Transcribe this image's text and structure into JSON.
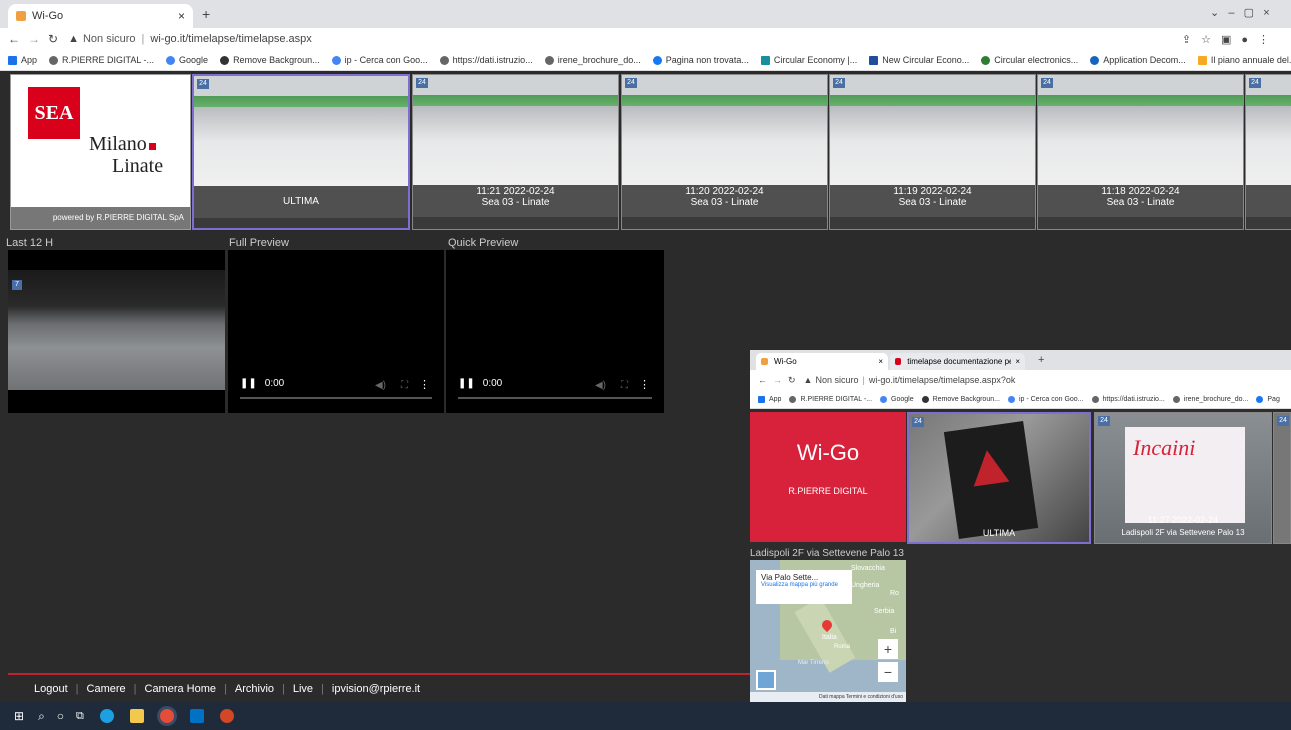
{
  "browser": {
    "tab_title": "Wi-Go",
    "address_prefix": "Non sicuro",
    "address": "wi-go.it/timelapse/timelapse.aspx",
    "bookmarks": [
      "App",
      "R.PIERRE DIGITAL -...",
      "Google",
      "Remove Backgroun...",
      "ip - Cerca con Goo...",
      "https://dati.istruzio...",
      "irene_brochure_do...",
      "Pagina non trovata...",
      "Circular Economy |...",
      "New Circular Econo...",
      "Circular electronics...",
      "Application Decom...",
      "Il piano annuale del..."
    ],
    "bookmarks_more": "»"
  },
  "logo": {
    "brand": "SEA",
    "line1": "Milano",
    "line2": "Linate",
    "powered": "powered by R.PIERRE DIGITAL SpA"
  },
  "thumbnails": [
    {
      "badge": "24",
      "caption1": "ULTIMA",
      "caption2": ""
    },
    {
      "badge": "24",
      "caption1": "11:21  2022-02-24",
      "caption2": "Sea 03 - Linate"
    },
    {
      "badge": "24",
      "caption1": "11:20  2022-02-24",
      "caption2": "Sea 03 - Linate"
    },
    {
      "badge": "24",
      "caption1": "11:19  2022-02-24",
      "caption2": "Sea 03 - Linate"
    },
    {
      "badge": "24",
      "caption1": "11:18  2022-02-24",
      "caption2": "Sea 03 - Linate"
    },
    {
      "badge": "24",
      "caption1": "",
      "caption2": ""
    }
  ],
  "sections": {
    "last": "Last 12 H",
    "full": "Full Preview",
    "quick": "Quick Preview"
  },
  "last_badge": "7",
  "video": {
    "time": "0:00"
  },
  "footer": {
    "links": [
      "Logout",
      "Camere",
      "Camera Home",
      "Archivio",
      "Live",
      "ipvision@rpierre.it"
    ]
  },
  "overlay": {
    "tab1": "Wi-Go",
    "tab2": "timelapse documentazione per ...",
    "address_prefix": "Non sicuro",
    "address": "wi-go.it/timelapse/timelapse.aspx?ok",
    "bookmarks": [
      "App",
      "R.PIERRE DIGITAL -...",
      "Google",
      "Remove Backgroun...",
      "ip - Cerca con Goo...",
      "https://dati.istruzio...",
      "irene_brochure_do...",
      "Pag"
    ],
    "brand_title": "Wi-Go",
    "brand_sub": "R.PIERRE DIGITAL",
    "thumb1_badge": "24",
    "thumb1_caption": "ULTIMA",
    "thumb2_badge": "24",
    "thumb2_text": "Incaini",
    "thumb2_caption1": "11:27  2022-02-24",
    "thumb2_caption2": "Ladispoli 2F via Settevene Palo 13",
    "thumb3_badge": "24",
    "location": "Ladispoli 2F via Settevene Palo 13",
    "map": {
      "popup_title": "Via Palo Sette...",
      "popup_link": "Visualizza mappa più grande",
      "labels": [
        "Slovacchia",
        "Ungheria",
        "Serbia",
        "Italia",
        "Roma",
        "Mar Tirreno",
        "Ro",
        "Bi"
      ],
      "zoom_in": "+",
      "zoom_out": "−",
      "attribution": "Dati mappa  Termini e condizioni d'uso"
    }
  },
  "colors": {
    "accent_red": "#c0232c",
    "sea_red": "#d9001b",
    "wigo_red": "#d8213b"
  }
}
